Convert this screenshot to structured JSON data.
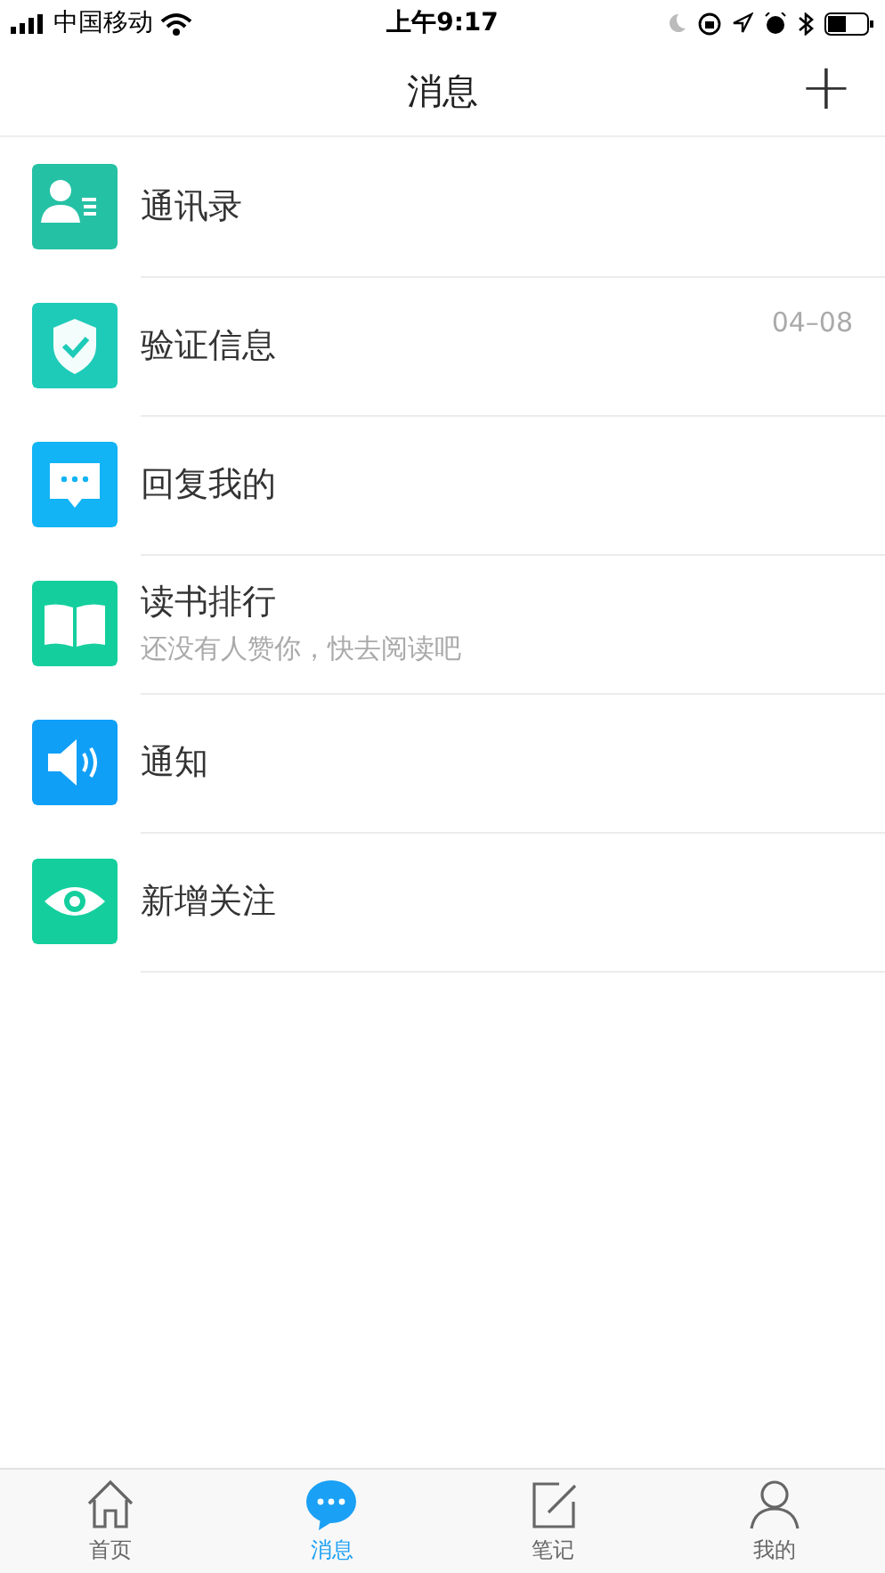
{
  "status_bar": {
    "carrier": "中国移动",
    "time": "上午9:17"
  },
  "header": {
    "title": "消息",
    "action": "+"
  },
  "items": [
    {
      "kind": "contacts",
      "title": "通讯录",
      "color": "#25c1a5"
    },
    {
      "kind": "shield",
      "title": "验证信息",
      "date": "04–08",
      "color": "#1ecbb8"
    },
    {
      "kind": "chat",
      "title": "回复我的",
      "color": "#12b4f5"
    },
    {
      "kind": "book",
      "title": "读书排行",
      "subtitle": "还没有人赞你，快去阅读吧",
      "color": "#14cf9d"
    },
    {
      "kind": "speaker",
      "title": "通知",
      "color": "#109ff7"
    },
    {
      "kind": "eye",
      "title": "新增关注",
      "color": "#14cf9d"
    }
  ],
  "tabs": [
    {
      "kind": "home",
      "label": "首页",
      "selected": false
    },
    {
      "kind": "chat",
      "label": "消息",
      "selected": true
    },
    {
      "kind": "note",
      "label": "笔记",
      "selected": false
    },
    {
      "kind": "person",
      "label": "我的",
      "selected": false
    }
  ]
}
